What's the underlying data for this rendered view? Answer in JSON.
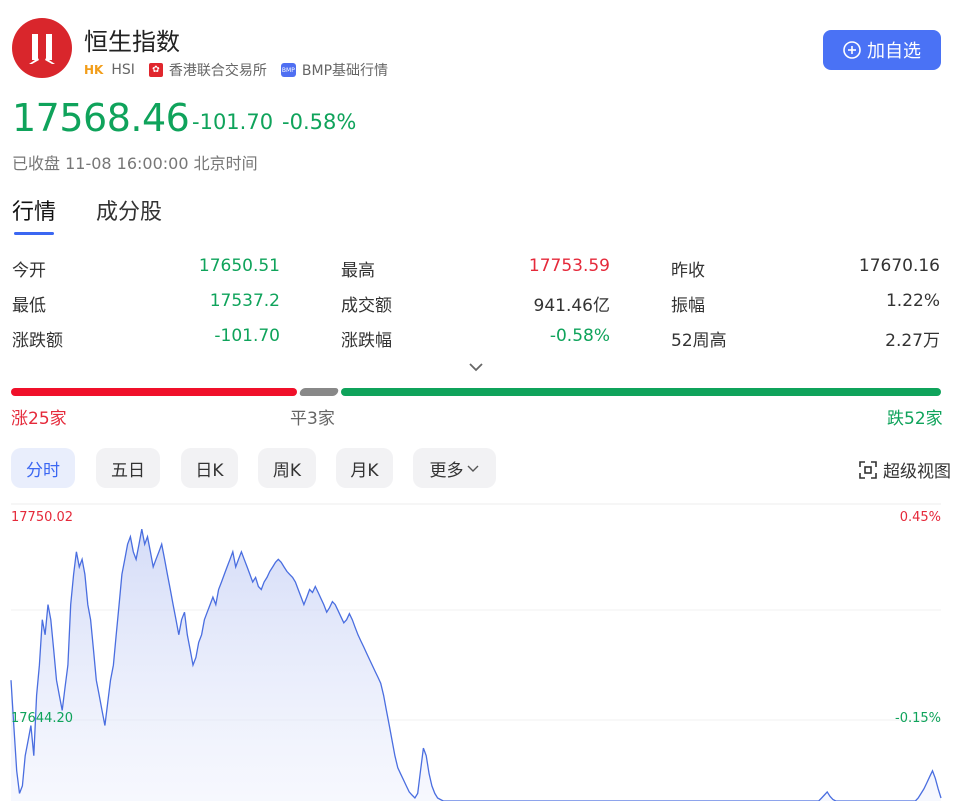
{
  "header": {
    "title": "恒生指数",
    "market": "HK",
    "code": "HSI",
    "exchange": "香港联合交易所",
    "data_source": "BMP基础行情",
    "add_button": "加自选"
  },
  "quote": {
    "price": "17568.46",
    "change": "-101.70",
    "change_pct": "-0.58%",
    "status": "已收盘 11-08 16:00:00 北京时间"
  },
  "tabs": [
    "行情",
    "成分股"
  ],
  "stats": {
    "open_label": "今开",
    "open": "17650.51",
    "high_label": "最高",
    "high": "17753.59",
    "prev_close_label": "昨收",
    "prev_close": "17670.16",
    "low_label": "最低",
    "low": "17537.2",
    "turnover_label": "成交额",
    "turnover": "941.46亿",
    "amplitude_label": "振幅",
    "amplitude": "1.22%",
    "change_amt_label": "涨跌额",
    "change_amt": "-101.70",
    "change_pct_label": "涨跌幅",
    "change_pct": "-0.58%",
    "week52_high_label": "52周高",
    "week52_high": "2.27万"
  },
  "breadth": {
    "up": "涨25家",
    "flat": "平3家",
    "down": "跌52家",
    "up_count": 25,
    "flat_count": 3,
    "down_count": 52
  },
  "chart_buttons": [
    "分时",
    "五日",
    "日K",
    "周K",
    "月K",
    "更多"
  ],
  "super_view": "超级视图",
  "chart_data": {
    "type": "area",
    "y_top_label": "17750.02",
    "y_top_pct": "0.45%",
    "y_mid_label": "17644.20",
    "y_mid_pct": "-0.15%",
    "ylim": [
      17570,
      17760
    ],
    "x": [
      0,
      1,
      2,
      3,
      4,
      5,
      6,
      7,
      8,
      9,
      10,
      11,
      12,
      13,
      14,
      15,
      16,
      17,
      18,
      19,
      20,
      21,
      22,
      23,
      24,
      25,
      26,
      27,
      28,
      29,
      30,
      31,
      32,
      33,
      34,
      35,
      36,
      37,
      38,
      39,
      40,
      41,
      42,
      43,
      44,
      45,
      46,
      47,
      48,
      49,
      50,
      51,
      52,
      53,
      54,
      55,
      56,
      57,
      58,
      59,
      60,
      61,
      62,
      63,
      64,
      65,
      66,
      67,
      68,
      69,
      70,
      71,
      72,
      73,
      74,
      75,
      76,
      77,
      78,
      79,
      80,
      81,
      82,
      83,
      84,
      85,
      86,
      87,
      88,
      89,
      90,
      91,
      92,
      93,
      94,
      95,
      96,
      97,
      98,
      99,
      100,
      101,
      102,
      103,
      104,
      105,
      106,
      107,
      108,
      109,
      110,
      111,
      112,
      113,
      114,
      115,
      116,
      117,
      118,
      119,
      120,
      121,
      122,
      123,
      124,
      125,
      126,
      127,
      128,
      129,
      130,
      131,
      132,
      133,
      134,
      135,
      136,
      137,
      138,
      139,
      140,
      141,
      142,
      143,
      144,
      145,
      146,
      147,
      148,
      149,
      150,
      151,
      152,
      153,
      154,
      155,
      156,
      157,
      158,
      159,
      160,
      161,
      162,
      163,
      164,
      165,
      166,
      167,
      168,
      169,
      170,
      171,
      172,
      173,
      174,
      175,
      176,
      177,
      178,
      179,
      180,
      181,
      182,
      183,
      184,
      185,
      186,
      187,
      188,
      189,
      190,
      191,
      192,
      193,
      194,
      195,
      196,
      197,
      198,
      199,
      200,
      201,
      202,
      203,
      204,
      205,
      206,
      207,
      208,
      209,
      210,
      211,
      212,
      213,
      214,
      215,
      216,
      217,
      218,
      219,
      220,
      221,
      222,
      223,
      224,
      225,
      226,
      227,
      228,
      229,
      230,
      231,
      232,
      233,
      234,
      235,
      236,
      237,
      238,
      239,
      240,
      241,
      242,
      243,
      244,
      245,
      246,
      247,
      248,
      249,
      250,
      251,
      252,
      253,
      254,
      255,
      256,
      257,
      258,
      259,
      260,
      261,
      262,
      263,
      264,
      265,
      266,
      267,
      268,
      269,
      270,
      271,
      272,
      273,
      274,
      275,
      276,
      277,
      278,
      279,
      280,
      281,
      282,
      283,
      284,
      285,
      286,
      287,
      288,
      289,
      290,
      291,
      292,
      293,
      294,
      295,
      296,
      297,
      298,
      299,
      300,
      301,
      302,
      303,
      304,
      305,
      306,
      307,
      308,
      309,
      310,
      311,
      312,
      313,
      314,
      315,
      316,
      317,
      318,
      319,
      320,
      321,
      322,
      323,
      324,
      325,
      326,
      327,
      328,
      329,
      330
    ],
    "values": [
      17650,
      17620,
      17590,
      17575,
      17580,
      17600,
      17610,
      17620,
      17600,
      17640,
      17660,
      17690,
      17680,
      17700,
      17690,
      17670,
      17650,
      17640,
      17630,
      17645,
      17660,
      17700,
      17720,
      17735,
      17725,
      17730,
      17720,
      17700,
      17690,
      17670,
      17650,
      17640,
      17630,
      17620,
      17635,
      17650,
      17660,
      17680,
      17700,
      17720,
      17730,
      17740,
      17745,
      17735,
      17730,
      17740,
      17750,
      17740,
      17745,
      17735,
      17725,
      17730,
      17735,
      17740,
      17730,
      17720,
      17710,
      17700,
      17690,
      17680,
      17690,
      17695,
      17680,
      17670,
      17660,
      17665,
      17675,
      17680,
      17690,
      17695,
      17700,
      17705,
      17700,
      17710,
      17715,
      17720,
      17725,
      17730,
      17735,
      17725,
      17730,
      17735,
      17730,
      17725,
      17720,
      17715,
      17718,
      17712,
      17710,
      17715,
      17718,
      17722,
      17725,
      17728,
      17730,
      17728,
      17725,
      17722,
      17720,
      17718,
      17715,
      17710,
      17705,
      17700,
      17705,
      17710,
      17708,
      17712,
      17708,
      17704,
      17700,
      17695,
      17698,
      17702,
      17700,
      17696,
      17692,
      17688,
      17690,
      17694,
      17690,
      17685,
      17680,
      17676,
      17672,
      17668,
      17664,
      17660,
      17656,
      17652,
      17648,
      17640,
      17630,
      17620,
      17610,
      17600,
      17592,
      17588,
      17584,
      17580,
      17576,
      17574,
      17572,
      17575,
      17590,
      17605,
      17600,
      17588,
      17580,
      17575,
      17572,
      17571,
      17570,
      17570,
      17570,
      17570,
      17570,
      17570,
      17570,
      17570,
      17570,
      17570,
      17570,
      17570,
      17570,
      17570,
      17570,
      17570,
      17570,
      17570,
      17570,
      17570,
      17570,
      17570,
      17570,
      17570,
      17570,
      17570,
      17570,
      17570,
      17570,
      17570,
      17570,
      17570,
      17570,
      17570,
      17570,
      17570,
      17570,
      17570,
      17570,
      17570,
      17570,
      17570,
      17570,
      17570,
      17570,
      17570,
      17570,
      17570,
      17570,
      17570,
      17570,
      17570,
      17570,
      17570,
      17570,
      17570,
      17570,
      17570,
      17570,
      17570,
      17570,
      17570,
      17570,
      17570,
      17570,
      17570,
      17570,
      17570,
      17570,
      17570,
      17570,
      17570,
      17570,
      17570,
      17570,
      17570,
      17570,
      17570,
      17570,
      17570,
      17570,
      17570,
      17570,
      17570,
      17570,
      17570,
      17570,
      17570,
      17570,
      17570,
      17570,
      17570,
      17570,
      17570,
      17570,
      17570,
      17570,
      17570,
      17570,
      17570,
      17570,
      17570,
      17570,
      17570,
      17570,
      17570,
      17570,
      17570,
      17570,
      17570,
      17570,
      17570,
      17570,
      17570,
      17570,
      17570,
      17570,
      17570,
      17570,
      17570,
      17570,
      17570,
      17570,
      17570,
      17570,
      17570,
      17570,
      17570,
      17570,
      17570,
      17570,
      17570,
      17570,
      17572,
      17574,
      17576,
      17573,
      17571,
      17570,
      17570,
      17570,
      17570,
      17570,
      17570,
      17570,
      17570,
      17570,
      17570,
      17570,
      17570,
      17570,
      17570,
      17570,
      17570,
      17570,
      17570,
      17570,
      17570,
      17570,
      17570,
      17570,
      17570,
      17570,
      17570,
      17570,
      17570,
      17570,
      17572,
      17575,
      17578,
      17582,
      17586,
      17590,
      17585,
      17578,
      17572
    ]
  },
  "colors": {
    "up": "#e5293a",
    "down": "#0fa35b",
    "accent": "#4a72f5",
    "line": "#4a6ee0"
  }
}
